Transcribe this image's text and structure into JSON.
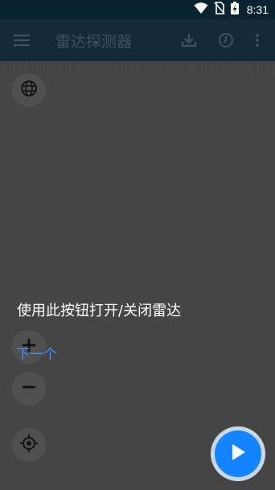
{
  "status_bar": {
    "time": "8:31"
  },
  "app_bar": {
    "title": "雷达探测器"
  },
  "overlay": {
    "hint": "使用此按钮打开/关闭雷达",
    "next": "下一个"
  },
  "colors": {
    "overlay_bg": "#454545",
    "app_bar_bg": "#152a38",
    "status_bar_bg": "#0a2330",
    "accent": "#1483ff",
    "link": "#3a95ff"
  },
  "icons": {
    "menu": "menu-icon",
    "download": "download-icon",
    "history": "clock-icon",
    "more": "more-vert-icon",
    "map_layer": "globe-icon",
    "zoom_in": "plus-icon",
    "zoom_out": "minus-icon",
    "locate": "crosshair-icon",
    "radar_toggle": "play-icon"
  }
}
